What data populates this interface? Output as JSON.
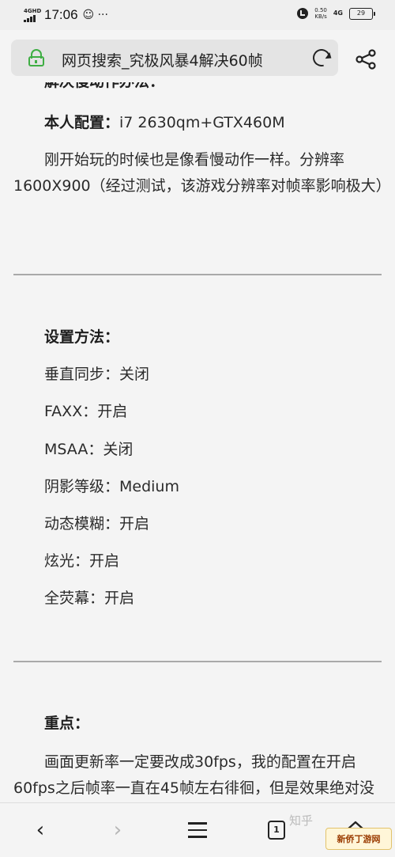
{
  "status_bar": {
    "network_left": "4GHD",
    "time": "17:06",
    "icons": "☺ ···",
    "speed_value": "0.50",
    "speed_unit": "KB/s",
    "network_right": "4G",
    "battery": "29"
  },
  "address_bar": {
    "title": "网页搜索_究极风暴4解决60帧"
  },
  "article": {
    "cut_heading": "解决慢动作办法：",
    "config_label": "本人配置：",
    "config_value": "i7 2630qm+GTX460M",
    "intro": "刚开始玩的时候也是像看慢动作一样。分辨率1600X900（经过测试，该游戏分辨率对帧率影响极大）",
    "settings_title": "设置方法：",
    "settings": [
      "垂直同步：关闭",
      "FAXX：开启",
      "MSAA：关闭",
      "阴影等级：Medium",
      "动态模糊：开启",
      "炫光：开启",
      "全荧幕：开启"
    ],
    "key_title": "重点：",
    "key_text": "画面更新率一定要改成30fps，我的配置在开启60fps之后帧率一直在45帧左右徘徊，但是效果绝对没"
  },
  "bottom_nav": {
    "back_icon": "chevron-left-icon",
    "forward_icon": "chevron-right-icon",
    "menu_icon": "menu-icon",
    "tabs_count": "1",
    "home_icon": "home-icon"
  },
  "watermark": "知乎",
  "site_badge": "新侨丁游网"
}
